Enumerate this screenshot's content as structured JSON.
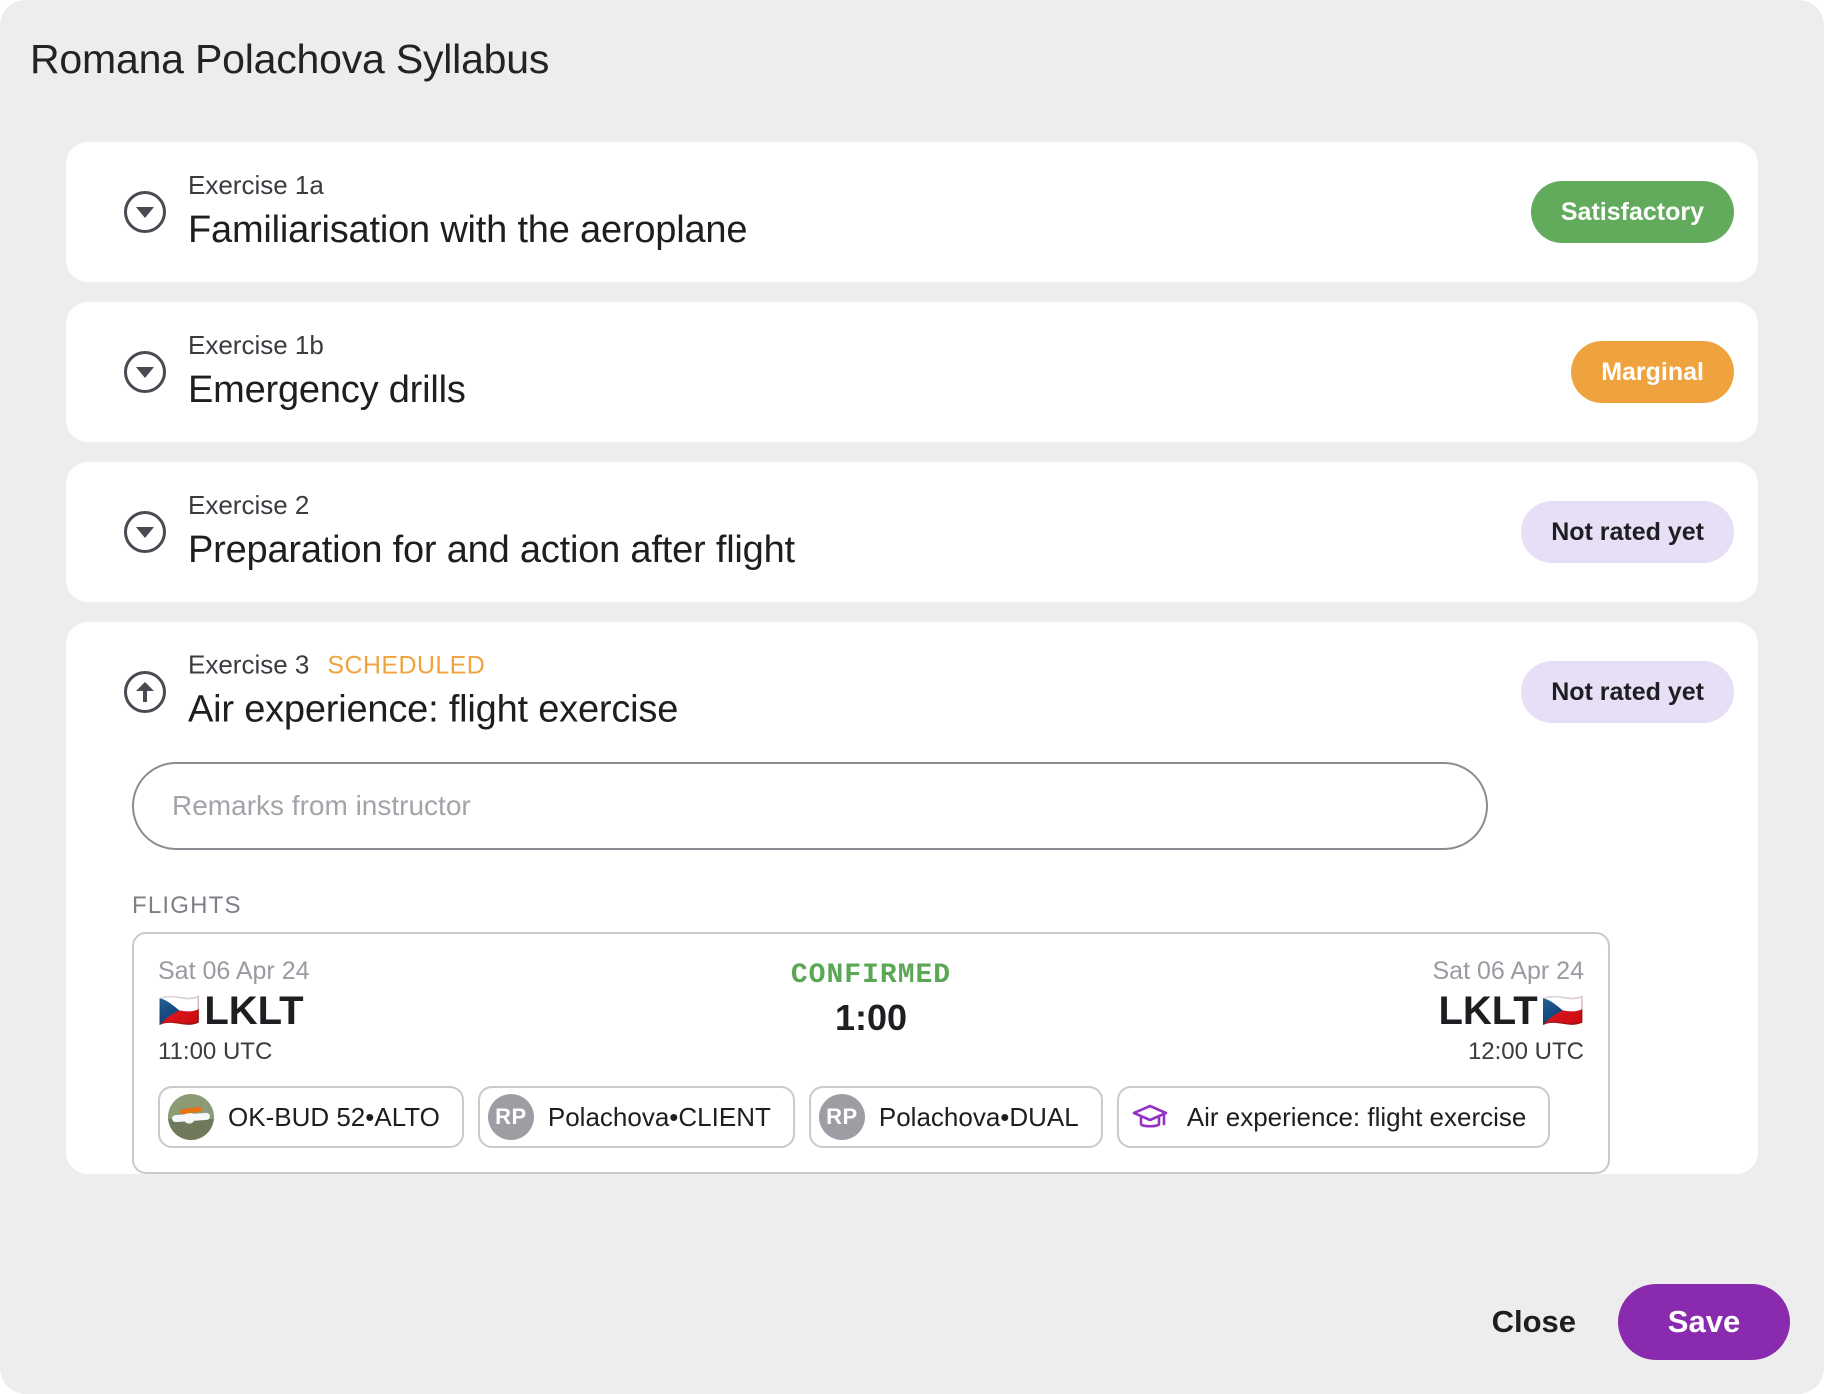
{
  "header": {
    "title": "Romana Polachova Syllabus"
  },
  "colors": {
    "page_background": "#ededed",
    "card_background": "#ffffff",
    "satisfactory": "#62ab5c",
    "marginal": "#efa33f",
    "not_rated_bg": "#e6dff5",
    "scheduled_text": "#f0a33d",
    "confirmed_text": "#5ca755",
    "save_button": "#8a2baf",
    "graduation_cap": "#9333c4"
  },
  "exercises": [
    {
      "number": "Exercise 1a",
      "title": "Familiarisation with the aeroplane",
      "tag": "",
      "status": "Satisfactory",
      "status_kind": "satisfactory",
      "toggle_icon": "chevron-down-circle-icon",
      "expanded": false
    },
    {
      "number": "Exercise 1b",
      "title": "Emergency drills",
      "tag": "",
      "status": "Marginal",
      "status_kind": "marginal",
      "toggle_icon": "chevron-down-circle-icon",
      "expanded": false
    },
    {
      "number": "Exercise 2",
      "title": "Preparation for and action after flight",
      "tag": "",
      "status": "Not rated yet",
      "status_kind": "notrated",
      "toggle_icon": "chevron-down-circle-icon",
      "expanded": false
    },
    {
      "number": "Exercise 3",
      "title": "Air experience: flight exercise",
      "tag": "SCHEDULED",
      "status": "Not rated yet",
      "status_kind": "notrated",
      "toggle_icon": "arrow-up-circle-icon",
      "expanded": true
    }
  ],
  "expanded_panel": {
    "remarks": {
      "value": "",
      "placeholder": "Remarks from instructor"
    },
    "flights_label": "FLIGHTS",
    "flight": {
      "departure": {
        "date": "Sat 06 Apr 24",
        "icao": "LKLT",
        "flag": "🇨🇿",
        "time": "11:00 UTC"
      },
      "arrival": {
        "date": "Sat 06 Apr 24",
        "icao": "LKLT",
        "flag": "🇨🇿",
        "time": "12:00 UTC"
      },
      "status": "CONFIRMED",
      "duration": "1:00",
      "chips": [
        {
          "label": "OK-BUD 52•ALTO",
          "avatar_kind": "photo",
          "avatar_text": "",
          "icon": "aircraft-photo-icon"
        },
        {
          "label": "Polachova•CLIENT",
          "avatar_kind": "initials",
          "avatar_text": "RP",
          "icon": "avatar-initials-icon"
        },
        {
          "label": "Polachova•DUAL",
          "avatar_kind": "initials",
          "avatar_text": "RP",
          "icon": "avatar-initials-icon"
        },
        {
          "label": "Air experience: flight exercise",
          "avatar_kind": "cap",
          "avatar_text": "",
          "icon": "graduation-cap-icon"
        }
      ]
    }
  },
  "footer": {
    "close_label": "Close",
    "save_label": "Save"
  }
}
